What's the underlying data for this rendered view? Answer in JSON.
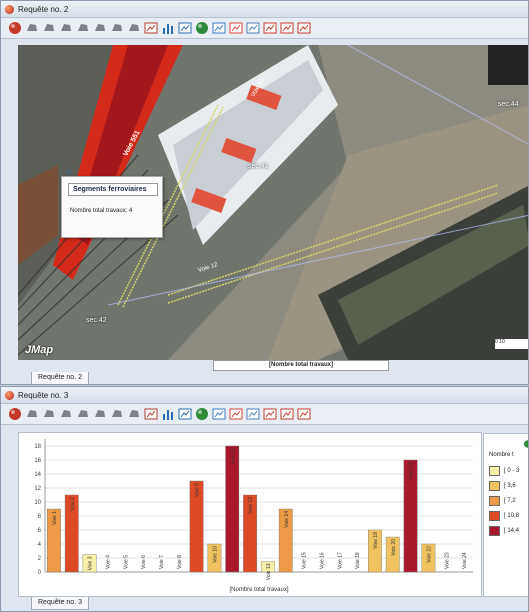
{
  "window1": {
    "title": "Requête no. 2",
    "tab_label": "Requête no. 2",
    "map": {
      "labels": [
        "sec.44",
        "sec.41",
        "sec.42",
        "Voie 551",
        "Voie 12",
        "Voie 15"
      ],
      "popup": {
        "title": "Segments ferroviaires",
        "text": "Nombre total travaux: 4"
      },
      "legend_label": "[Nombre total travaux]",
      "logo": "JMap",
      "scale": "0  10"
    }
  },
  "window2": {
    "title": "Requête no. 3",
    "tab_label": "Requête no. 3"
  },
  "toolbar_icons": [
    "globe-icon",
    "shape-icon",
    "shape-icon",
    "shape-icon",
    "shape-icon",
    "shape-icon",
    "shape-icon",
    "shape-icon",
    "grid-icon",
    "bar-chart-icon",
    "table-icon",
    "pie-chart-icon",
    "line-chart-icon",
    "area-chart-icon",
    "map-icon",
    "cube-icon",
    "house-icon",
    "gauge-icon"
  ],
  "colors": {
    "bin1": "#f7f0a8",
    "bin2": "#f0c360",
    "bin3": "#ec9a45",
    "bin4": "#dd4a25",
    "bin5": "#a8172b"
  },
  "legend": {
    "name": "Nombre t",
    "items": [
      "[ 0 - 3",
      "[ 3,6",
      "[ 7,2",
      "[ 10,8",
      "[ 14,4"
    ]
  },
  "chart_data": {
    "type": "bar",
    "xlabel": "[Nombre total travaux]",
    "ylim": [
      0,
      19
    ],
    "yticks": [
      0,
      2,
      4,
      6,
      8,
      10,
      12,
      14,
      16,
      18
    ],
    "values": [
      9,
      11,
      2.5,
      0,
      0,
      0,
      0,
      0,
      13,
      4,
      18,
      11,
      1.5,
      9,
      0,
      0,
      0,
      0,
      6,
      5,
      16,
      4,
      0,
      0
    ],
    "bins": [
      3,
      4,
      1,
      1,
      1,
      1,
      1,
      1,
      4,
      2,
      5,
      4,
      1,
      3,
      1,
      1,
      1,
      1,
      2,
      2,
      5,
      2,
      1,
      1
    ],
    "labels": [
      "Voie 1",
      "Voie 2",
      "Voie 3",
      "Voie 4",
      "Voie 5",
      "Voie 6",
      "Voie 7",
      "Voie 8",
      "Voie 9",
      "Voie 10",
      "Voie 11",
      "Voie 12",
      "Voie 13",
      "Voie 14",
      "Voie 15",
      "Voie 16",
      "Voie 17",
      "Voie 18",
      "Voie 19",
      "Voie 20",
      "Voie 21",
      "Voie 22",
      "Voie 23",
      "Voie 24"
    ]
  }
}
